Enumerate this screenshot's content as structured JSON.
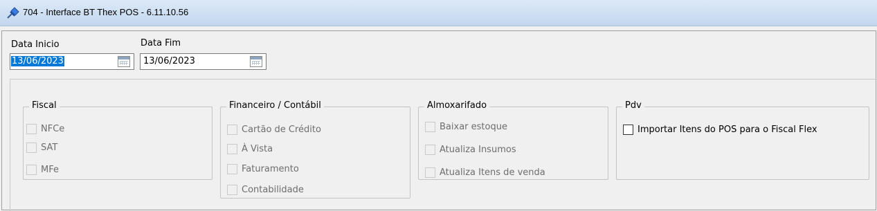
{
  "window": {
    "title": "704 - Interface BT Thex POS - 6.11.10.56"
  },
  "dates": {
    "start_label": "Data Inicio",
    "start_value": "13/06/2023",
    "end_label": "Data Fim",
    "end_value": "13/06/2023"
  },
  "groups": {
    "fiscal": {
      "label": "Fiscal",
      "items": [
        "NFCe",
        "SAT",
        "MFe"
      ]
    },
    "financeiro": {
      "label": "Financeiro / Contábil",
      "items": [
        "Cartão de Crédito",
        "À Vista",
        "Faturamento",
        "Contabilidade"
      ]
    },
    "almoxarifado": {
      "label": "Almoxarifado",
      "items": [
        "Baixar estoque",
        "Atualiza Insumos",
        "Atualiza Itens de venda"
      ]
    },
    "pdv": {
      "label": "Pdv",
      "items": [
        "Importar Itens do POS para o Fiscal Flex"
      ]
    }
  },
  "colors": {
    "selection": "#0078d7",
    "disabled_text": "#6d6d6d",
    "titlebar": "#cfe0f3"
  },
  "icons": {
    "title": "pin-icon",
    "date_picker": "calendar-icon"
  }
}
